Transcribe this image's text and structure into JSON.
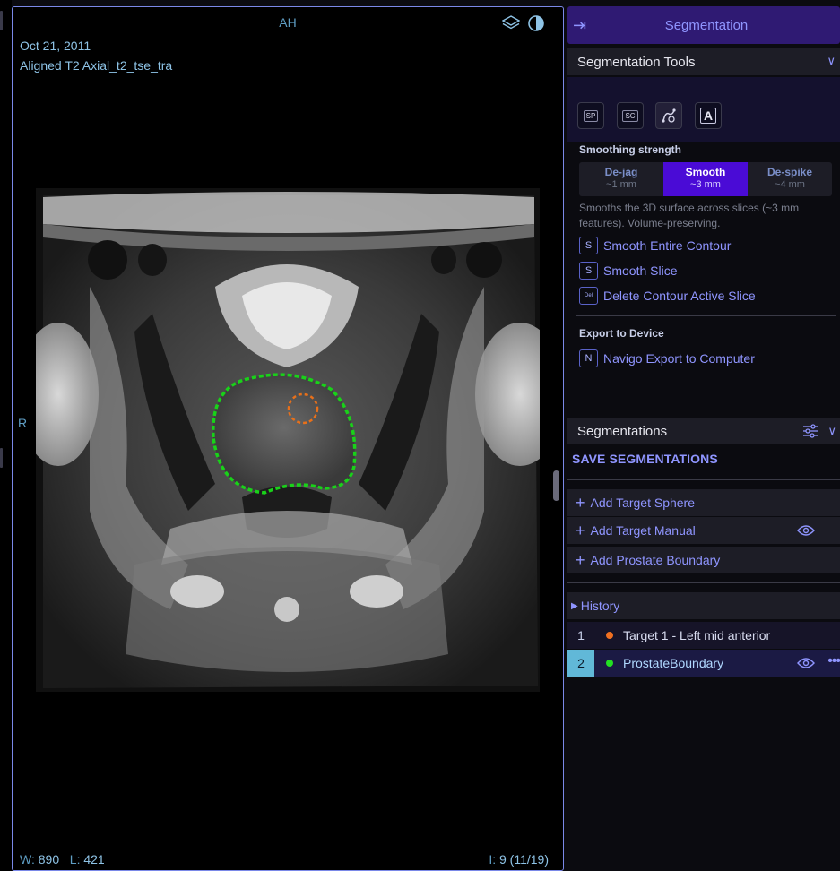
{
  "viewport": {
    "orientation_top": "AH",
    "orientation_left": "R",
    "date": "Oct 21, 2011",
    "series": "Aligned T2 Axial_t2_tse_tra",
    "window_label": "W:",
    "window_value": "890",
    "level_label": "L:",
    "level_value": "421",
    "image_label": "I:",
    "image_value": "9 (11/19)",
    "icons": [
      "layers-icon",
      "contrast-icon"
    ],
    "prostate_contour_color": "#19d219",
    "target_contour_color": "#e8701a"
  },
  "panel": {
    "header_title": "Segmentation",
    "tools_section": "Segmentation Tools",
    "tools": [
      {
        "label": "SP",
        "name": "sphere-tool-button"
      },
      {
        "label": "SC",
        "name": "scissors-tool-button"
      },
      {
        "label": "",
        "name": "spline-tool-button"
      },
      {
        "label": "A",
        "name": "annotate-tool-button"
      }
    ],
    "smoothing_label": "Smoothing strength",
    "smoothing_options": [
      {
        "name": "De-jag",
        "detail": "~1 mm"
      },
      {
        "name": "Smooth",
        "detail": "~3 mm"
      },
      {
        "name": "De-spike",
        "detail": "~4 mm"
      }
    ],
    "smoothing_selected": "Smooth",
    "smoothing_desc": "Smooths the 3D surface across slices (~3 mm features). Volume-preserving.",
    "actions": [
      {
        "key": "S",
        "label": "Smooth Entire Contour"
      },
      {
        "key": "S",
        "label": "Smooth Slice"
      },
      {
        "key": "Del",
        "label": "Delete Contour Active Slice"
      }
    ],
    "export_label": "Export to Device",
    "export_action": {
      "key": "N",
      "label": "Navigo Export to Computer"
    },
    "segmentations_section": "Segmentations",
    "save_label": "SAVE SEGMENTATIONS",
    "add_rows": [
      "Add Target Sphere",
      "Add Target Manual",
      "Add Prostate Boundary"
    ],
    "history_label": "History",
    "history_rows": [
      {
        "num": "1",
        "label": "Target 1 - Left mid anterior",
        "color": "#f07020"
      },
      {
        "num": "2",
        "label": "ProstateBoundary",
        "color": "#22e022"
      }
    ],
    "accent": "#8f95ff",
    "header_bg": "#2f1a73",
    "selected_bg": "#4a0bd6"
  }
}
